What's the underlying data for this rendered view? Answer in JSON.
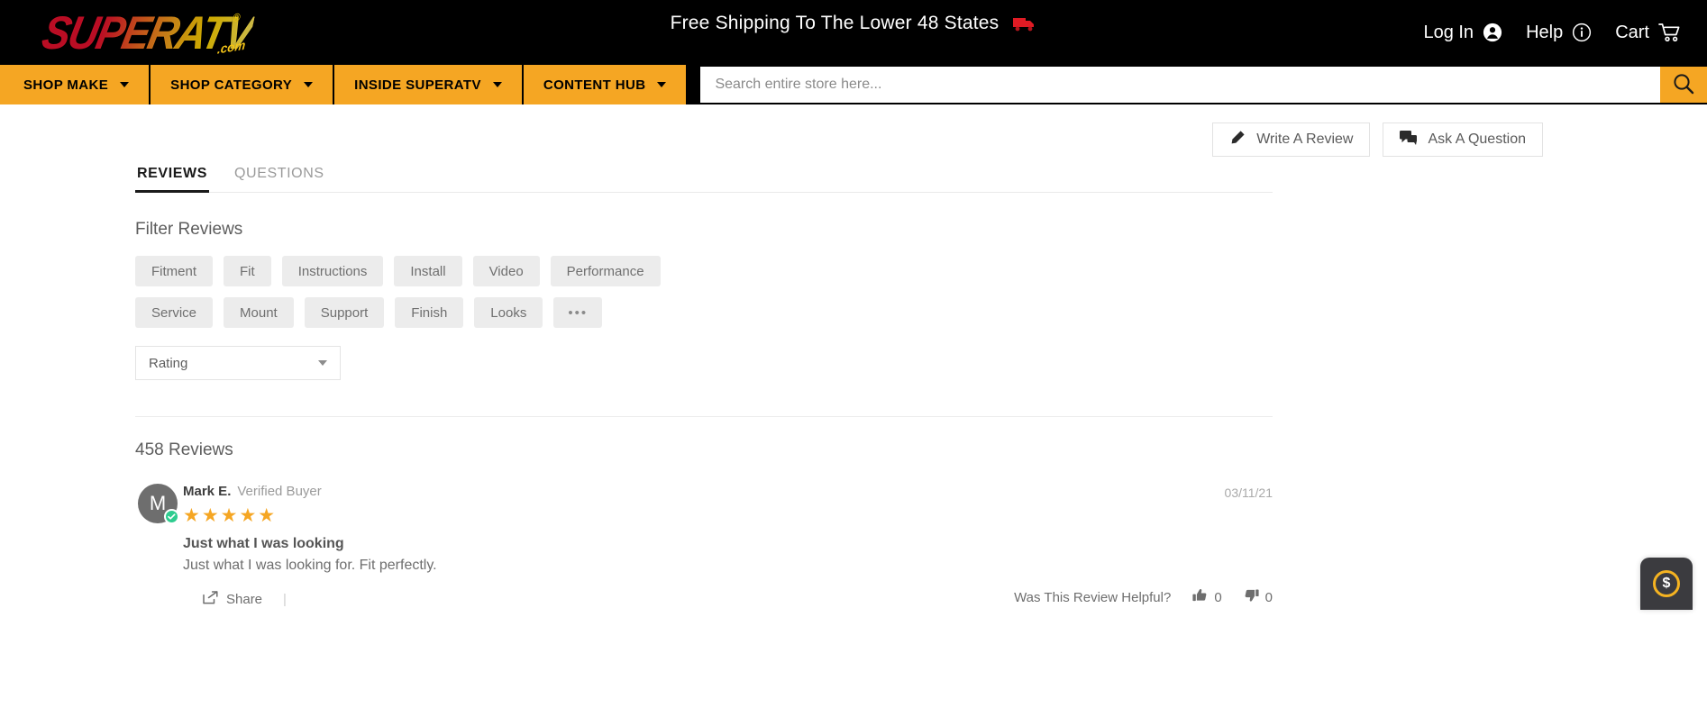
{
  "header": {
    "logo": {
      "brand": "SUPERATV",
      "suffix": ".com",
      "registered": "®"
    },
    "promo": {
      "text": "Free Shipping To The Lower 48 States",
      "icon": "truck-icon"
    },
    "account": [
      {
        "label": "Log In",
        "icon": "user-circle-icon"
      },
      {
        "label": "Help",
        "icon": "info-circle-icon"
      },
      {
        "label": "Cart",
        "icon": "shopping-cart-icon"
      }
    ]
  },
  "nav": {
    "items": [
      {
        "label": "SHOP MAKE",
        "icon": "chevron-down-icon"
      },
      {
        "label": "SHOP CATEGORY",
        "icon": "chevron-down-icon"
      },
      {
        "label": "INSIDE SUPERATV",
        "icon": "chevron-down-icon"
      },
      {
        "label": "CONTENT HUB",
        "icon": "chevron-down-icon"
      }
    ],
    "search": {
      "placeholder": "Search entire store here...",
      "value": "",
      "button_icon": "search-icon"
    }
  },
  "actions": {
    "write_review": {
      "label": "Write A Review",
      "icon": "pencil-icon"
    },
    "ask_question": {
      "label": "Ask A Question",
      "icon": "chat-bubbles-icon"
    }
  },
  "tabs": [
    {
      "label": "REVIEWS",
      "active": true
    },
    {
      "label": "QUESTIONS",
      "active": false
    }
  ],
  "filters": {
    "title": "Filter Reviews",
    "row1": [
      "Fitment",
      "Fit",
      "Instructions",
      "Install",
      "Video",
      "Performance"
    ],
    "row2": [
      "Service",
      "Mount",
      "Support",
      "Finish",
      "Looks"
    ],
    "more": "•••",
    "sort": {
      "label": "Rating",
      "icon": "chevron-down-icon"
    }
  },
  "reviews_section": {
    "count_label": "458 Reviews",
    "items": [
      {
        "avatar_initial": "M",
        "author": "Mark E.",
        "verified_label": "Verified Buyer",
        "date": "03/11/21",
        "stars": "★★★★★",
        "rating": 5,
        "title": "Just what I was looking",
        "body": "Just what I was looking for. Fit perfectly.",
        "share_label": "Share",
        "helpful_label": "Was This Review Helpful?",
        "up_count": "0",
        "down_count": "0"
      }
    ]
  },
  "rewards_widget": {
    "symbol": "$",
    "name": "rewards-widget"
  },
  "colors": {
    "brand_orange": "#f5a623",
    "star_orange": "#f5a623",
    "header_black": "#000000",
    "verified_green": "#2ecc8f"
  }
}
